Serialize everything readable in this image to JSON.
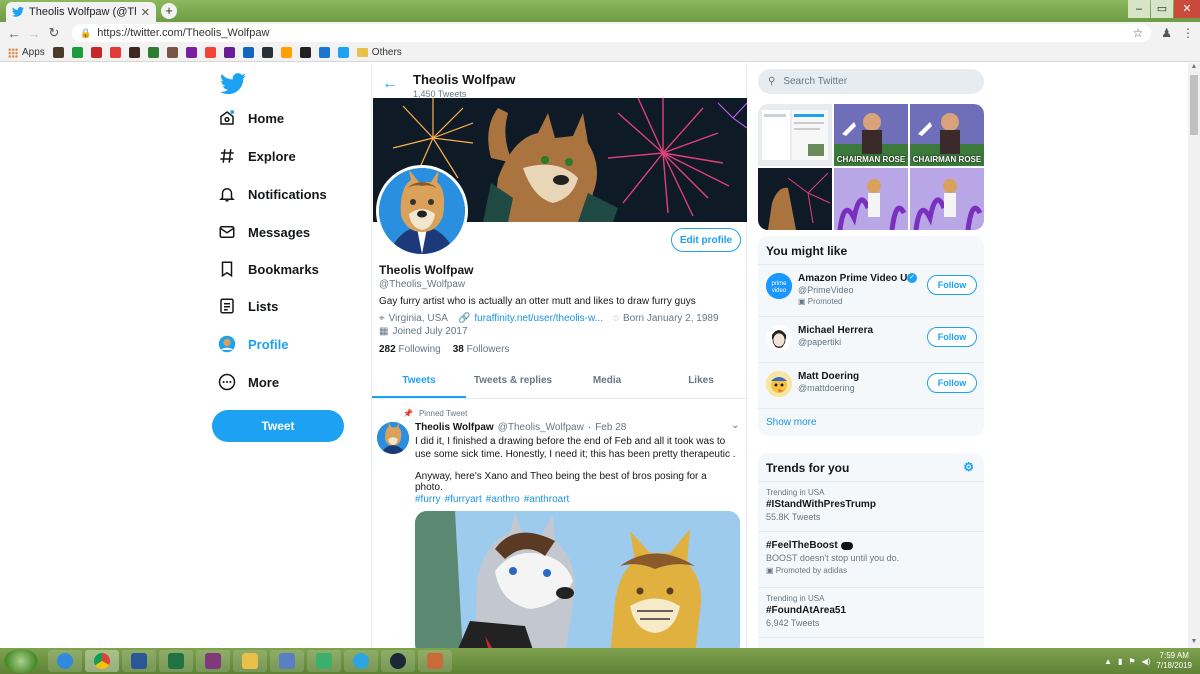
{
  "browser": {
    "tab_title": "Theolis Wolfpaw (@Theolis_Wol",
    "url": "https://twitter.com/Theolis_Wolfpaw",
    "bookmarks": {
      "apps_label": "Apps",
      "others_label": "Others",
      "icon_colors": [
        "#4a3a2a",
        "#1c9c3c",
        "#c62828",
        "#e53935",
        "#3e2723",
        "#2e7d32",
        "#795548",
        "#7b1fa2",
        "#f44336",
        "#6a1b9a",
        "#1565c0",
        "#263238",
        "#ffa000",
        "#212121",
        "#1976d2",
        "#1da1f2"
      ]
    }
  },
  "nav": {
    "items": [
      {
        "label": "Home",
        "icon": "home-icon"
      },
      {
        "label": "Explore",
        "icon": "hash-icon"
      },
      {
        "label": "Notifications",
        "icon": "bell-icon"
      },
      {
        "label": "Messages",
        "icon": "envelope-icon"
      },
      {
        "label": "Bookmarks",
        "icon": "bookmark-icon"
      },
      {
        "label": "Lists",
        "icon": "list-icon"
      },
      {
        "label": "Profile",
        "icon": "profile-avatar-icon"
      },
      {
        "label": "More",
        "icon": "more-icon"
      }
    ],
    "tweet_label": "Tweet"
  },
  "profile": {
    "header_name": "Theolis Wolfpaw",
    "header_count": "1,450 Tweets",
    "edit_label": "Edit profile",
    "name": "Theolis Wolfpaw",
    "handle": "@Theolis_Wolfpaw",
    "bio": "Gay furry artist who is actually an otter mutt and likes to draw furry guys",
    "location": "Virginia, USA",
    "link": "furaffinity.net/user/theolis-w...",
    "born": "Born January 2, 1989",
    "joined": "Joined July 2017",
    "following_count": "282",
    "following_label": "Following",
    "followers_count": "38",
    "followers_label": "Followers",
    "tabs": [
      "Tweets",
      "Tweets & replies",
      "Media",
      "Likes"
    ]
  },
  "tweet": {
    "pinned_label": "Pinned Tweet",
    "name": "Theolis Wolfpaw",
    "handle": "@Theolis_Wolfpaw",
    "dot": "·",
    "date": "Feb 28",
    "text1": "I did it, I finished a drawing before the end of Feb and all it took was to use some sick time. Honestly, I need it; this has been pretty therapeutic .",
    "text2": "Anyway, here's Xano and Theo being the best of bros posing for a photo.",
    "tags": [
      "#furry",
      "#furryart",
      "#anthro",
      "#anthroart"
    ]
  },
  "right": {
    "search_placeholder": "Search Twitter",
    "media_caption": "CHAIRMAN ROSE",
    "wtf_title": "You might like",
    "wtf": [
      {
        "name": "Amazon Prime Video US",
        "handle": "@PrimeVideo",
        "promoted": "Promoted",
        "follow": "Follow"
      },
      {
        "name": "Michael Herrera",
        "handle": "@papertiki",
        "follow": "Follow"
      },
      {
        "name": "Matt Doering",
        "handle": "@mattdoering",
        "follow": "Follow"
      }
    ],
    "show_more": "Show more",
    "trends_title": "Trends for you",
    "trends": [
      {
        "sub": "Trending in USA",
        "tag": "#IStandWithPresTrump",
        "count": "55.8K Tweets"
      },
      {
        "sub": "",
        "tag": "#FeelTheBoost",
        "count": "BOOST doesn't stop until you do.",
        "promo": "Promoted by adidas"
      },
      {
        "sub": "Trending in USA",
        "tag": "#FoundAtArea51",
        "count": "6,942 Tweets"
      }
    ]
  },
  "taskbar": {
    "time": "7:59 AM",
    "date": "7/18/2019"
  }
}
